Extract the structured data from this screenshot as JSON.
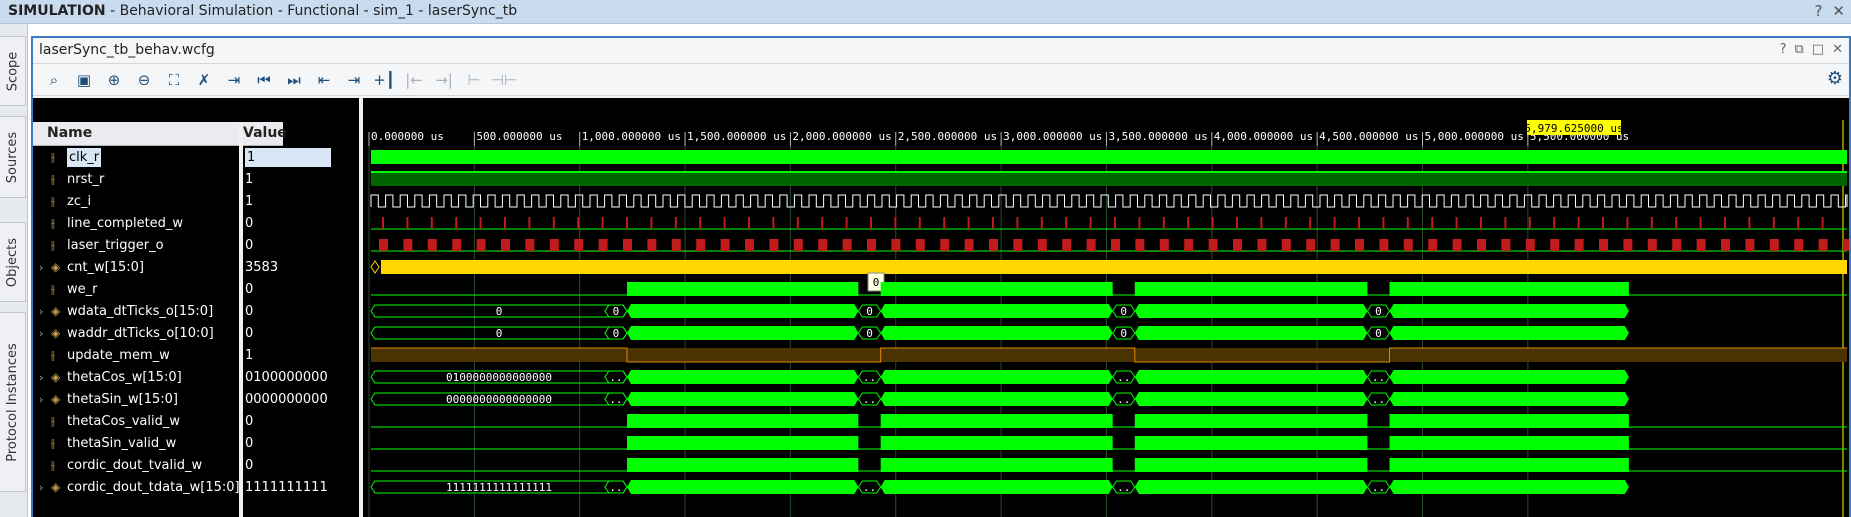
{
  "window": {
    "title_bold": "SIMULATION",
    "title_rest": " - Behavioral Simulation - Functional - sim_1 - laserSync_tb",
    "help_icon": "help-icon",
    "close_icon": "close-icon"
  },
  "side_tabs": [
    "Scope",
    "Sources",
    "Objects",
    "Protocol Instances"
  ],
  "panel": {
    "title": "laserSync_tb_behav.wcfg",
    "controls": [
      "?",
      "⧉",
      "□",
      "✕"
    ]
  },
  "toolbar": {
    "buttons": [
      "search",
      "save",
      "zoom-in",
      "zoom-out",
      "zoom-fit",
      "cursor-swap",
      "go-to-cursor",
      "go-to-time-0",
      "go-to-last-time",
      "previous-transition",
      "next-transition",
      "add-marker",
      "previous-marker",
      "next-marker",
      "swap-cursors",
      "snap-to-transition"
    ],
    "settings_icon": "gear-icon"
  },
  "columns": {
    "name": "Name",
    "value": "Value"
  },
  "cursor_time": "5,979.625000 us",
  "time_ruler": [
    "0.000000 us",
    "500.000000 us",
    "1,000.000000 us",
    "1,500.000000 us",
    "2,000.000000 us",
    "2,500.000000 us",
    "3,000.000000 us",
    "3,500.000000 us",
    "4,000.000000 us",
    "4,500.000000 us",
    "5,000.000000 us",
    "5,500.000000 us"
  ],
  "signals": [
    {
      "name": "clk_r",
      "value": "1",
      "bus": false,
      "selected": true
    },
    {
      "name": "nrst_r",
      "value": "1",
      "bus": false
    },
    {
      "name": "zc_i",
      "value": "1",
      "bus": false
    },
    {
      "name": "line_completed_w",
      "value": "0",
      "bus": false
    },
    {
      "name": "laser_trigger_o",
      "value": "0",
      "bus": false
    },
    {
      "name": "cnt_w[15:0]",
      "value": "3583",
      "bus": true
    },
    {
      "name": "we_r",
      "value": "0",
      "bus": false
    },
    {
      "name": "wdata_dtTicks_o[15:0]",
      "value": "0",
      "bus": true
    },
    {
      "name": "waddr_dtTicks_o[10:0]",
      "value": "0",
      "bus": true
    },
    {
      "name": "update_mem_w",
      "value": "1",
      "bus": false
    },
    {
      "name": "thetaCos_w[15:0]",
      "value": "0100000000",
      "bus": true
    },
    {
      "name": "thetaSin_w[15:0]",
      "value": "0000000000",
      "bus": true
    },
    {
      "name": "thetaCos_valid_w",
      "value": "0",
      "bus": false
    },
    {
      "name": "thetaSin_valid_w",
      "value": "0",
      "bus": false
    },
    {
      "name": "cordic_dout_tvalid_w",
      "value": "0",
      "bus": false
    },
    {
      "name": "cordic_dout_tdata_w[15:0]",
      "value": "1111111111",
      "bus": true
    }
  ],
  "wave_labels": {
    "wdata": "0",
    "waddr": "0",
    "thetaCos": "0100000000000000",
    "thetaSin": "0000000000000000",
    "cordic": "1111111111111111",
    "short_zero": "0",
    "short_dots": "..",
    "tooltip": "0"
  },
  "colors": {
    "green": "#00ff00",
    "dark_green": "#006400",
    "yellow": "#ffd700",
    "red": "#c01c1c",
    "cursor_label_bg": "#ffff00",
    "orange_line": "#e08a00"
  }
}
